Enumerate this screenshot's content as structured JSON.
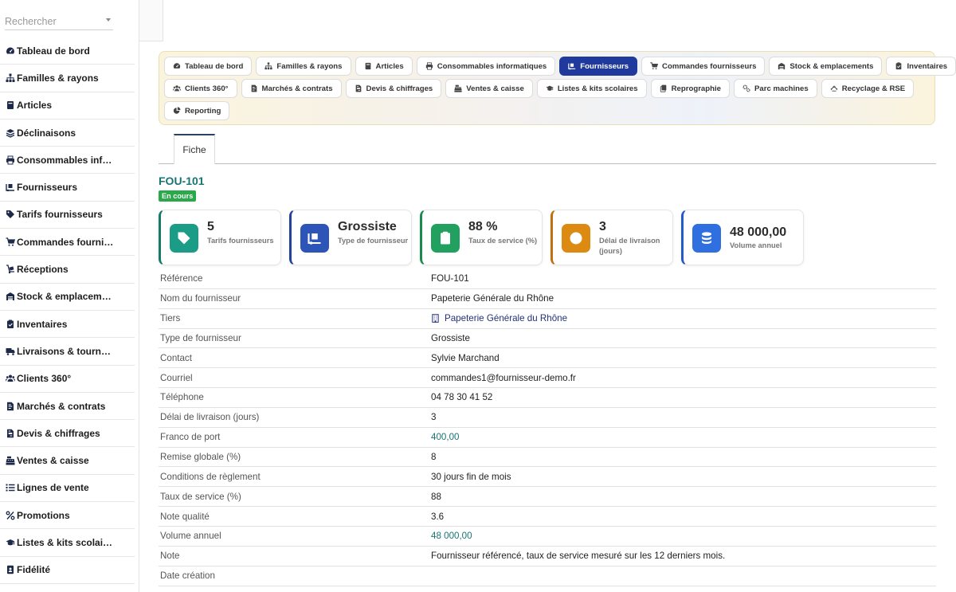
{
  "search": {
    "placeholder": "Rechercher"
  },
  "sidebar": {
    "items": [
      {
        "label": "Tableau de bord",
        "icon": "gauge-icon"
      },
      {
        "label": "Familles & rayons",
        "icon": "sitemap-icon"
      },
      {
        "label": "Articles",
        "icon": "book-icon"
      },
      {
        "label": "Déclinaisons",
        "icon": "layers-icon"
      },
      {
        "label": "Consommables informatiques",
        "icon": "printer-icon"
      },
      {
        "label": "Fournisseurs",
        "icon": "truck-ramp-icon"
      },
      {
        "label": "Tarifs fournisseurs",
        "icon": "tags-icon"
      },
      {
        "label": "Commandes fournisseurs",
        "icon": "cart-icon"
      },
      {
        "label": "Réceptions",
        "icon": "dolly-icon"
      },
      {
        "label": "Stock & emplacements",
        "icon": "warehouse-icon"
      },
      {
        "label": "Inventaires",
        "icon": "clipboard-check-icon"
      },
      {
        "label": "Livraisons & tournées",
        "icon": "truck-icon"
      },
      {
        "label": "Clients 360°",
        "icon": "users-icon"
      },
      {
        "label": "Marchés & contrats",
        "icon": "file-contract-icon"
      },
      {
        "label": "Devis & chiffrages",
        "icon": "file-invoice-icon"
      },
      {
        "label": "Ventes & caisse",
        "icon": "cash-register-icon"
      },
      {
        "label": "Lignes de vente",
        "icon": "list-icon"
      },
      {
        "label": "Promotions",
        "icon": "percent-icon"
      },
      {
        "label": "Listes & kits scolaires",
        "icon": "graduation-cap-icon"
      },
      {
        "label": "Fidélité",
        "icon": "id-badge-icon"
      }
    ]
  },
  "modules": {
    "rows": [
      [
        {
          "label": "Tableau de bord",
          "icon": "gauge-icon"
        },
        {
          "label": "Familles & rayons",
          "icon": "sitemap-icon"
        },
        {
          "label": "Articles",
          "icon": "book-icon"
        },
        {
          "label": "Consommables informatiques",
          "icon": "printer-icon"
        },
        {
          "label": "Fournisseurs",
          "icon": "truck-ramp-icon",
          "active": true
        },
        {
          "label": "Commandes fournisseurs",
          "icon": "cart-icon"
        },
        {
          "label": "Stock & emplacements",
          "icon": "warehouse-icon"
        },
        {
          "label": "Inventaires",
          "icon": "clipboard-check-icon"
        }
      ],
      [
        {
          "label": "Clients 360°",
          "icon": "users-icon"
        },
        {
          "label": "Marchés & contrats",
          "icon": "file-contract-icon"
        },
        {
          "label": "Devis & chiffrages",
          "icon": "file-invoice-icon"
        },
        {
          "label": "Ventes & caisse",
          "icon": "cash-register-icon"
        },
        {
          "label": "Listes & kits scolaires",
          "icon": "graduation-cap-icon"
        },
        {
          "label": "Reprographie",
          "icon": "copy-icon"
        },
        {
          "label": "Parc machines",
          "icon": "gears-icon"
        },
        {
          "label": "Recyclage & RSE",
          "icon": "recycle-icon"
        }
      ],
      [
        {
          "label": "Reporting",
          "icon": "pie-chart-icon"
        }
      ]
    ]
  },
  "tabs": {
    "fiche": "Fiche"
  },
  "record": {
    "title": "FOU-101",
    "status": "En cours"
  },
  "kpis": [
    {
      "value": "5",
      "caption": "Tarifs fournisseurs",
      "icon": "tags-icon",
      "color": "#1a9c86",
      "border": "#157a6b"
    },
    {
      "value": "Grossiste",
      "caption": "Type de fournisseur",
      "icon": "truck-ramp-icon",
      "color": "#2d55b8",
      "border": "#23429a"
    },
    {
      "value": "88 %",
      "caption": "Taux de service (%)",
      "icon": "clipboard-check-icon",
      "color": "#22a060",
      "border": "#1a8a4d"
    },
    {
      "value": "3",
      "caption": "Délai de livraison (jours)",
      "icon": "clock-icon",
      "color": "#dd8a12",
      "border": "#c07010"
    },
    {
      "value": "48 000,00",
      "caption": "Volume annuel",
      "icon": "coins-icon",
      "color": "#2f6fe0",
      "border": "#2459c8"
    }
  ],
  "fields": [
    {
      "label": "Référence",
      "value": "FOU-101"
    },
    {
      "label": "Nom du fournisseur",
      "value": "Papeterie Générale du Rhône"
    },
    {
      "label": "Tiers",
      "value": "Papeterie Générale du Rhône",
      "type": "link",
      "icon": "building-icon"
    },
    {
      "label": "Type de fournisseur",
      "value": "Grossiste"
    },
    {
      "label": "Contact",
      "value": "Sylvie Marchand"
    },
    {
      "label": "Courriel",
      "value": "commandes1@fournisseur-demo.fr"
    },
    {
      "label": "Téléphone",
      "value": "04 78 30 41 52"
    },
    {
      "label": "Délai de livraison (jours)",
      "value": "3"
    },
    {
      "label": "Franco de port",
      "value": "400,00",
      "type": "num"
    },
    {
      "label": "Remise globale (%)",
      "value": "8"
    },
    {
      "label": "Conditions de règlement",
      "value": "30 jours fin de mois"
    },
    {
      "label": "Taux de service (%)",
      "value": "88"
    },
    {
      "label": "Note qualité",
      "value": "3.6"
    },
    {
      "label": "Volume annuel",
      "value": "48 000,00",
      "type": "num"
    },
    {
      "label": "Note",
      "value": "Fournisseur référencé, taux de service mesuré sur les 12 derniers mois."
    },
    {
      "label": "Date création",
      "value": ""
    }
  ]
}
